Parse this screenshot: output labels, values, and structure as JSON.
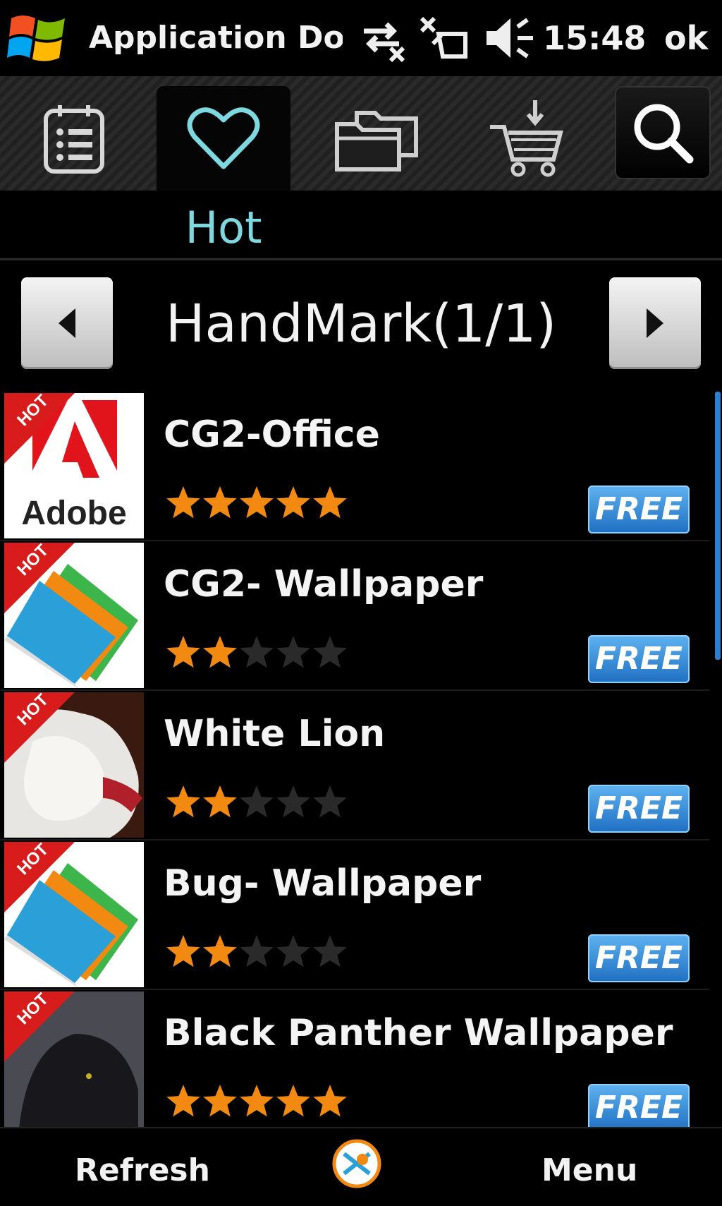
{
  "status_bar": {
    "app_title": "Application Dow",
    "time": "15:48",
    "ok_label": "ok",
    "icons": [
      "windows-start-icon",
      "connectivity-icon",
      "signal-off-icon",
      "volume-mute-icon"
    ]
  },
  "tabs": {
    "items": [
      {
        "icon": "list-icon"
      },
      {
        "icon": "heart-icon",
        "label": "Hot",
        "active": true
      },
      {
        "icon": "folders-icon"
      },
      {
        "icon": "cart-download-icon"
      }
    ],
    "search_icon": "search-icon",
    "active_label": "Hot"
  },
  "category": {
    "title": "HandMark(1/1)",
    "prev_icon": "chevron-left-icon",
    "next_icon": "chevron-right-icon"
  },
  "apps": [
    {
      "name": "CG2-Office",
      "rating": 5,
      "badge": "HOT",
      "price": "FREE",
      "thumb_text": "Adobe"
    },
    {
      "name": "CG2- Wallpaper",
      "rating": 2,
      "badge": "HOT",
      "price": "FREE"
    },
    {
      "name": "White Lion",
      "rating": 2,
      "badge": "HOT",
      "price": "FREE"
    },
    {
      "name": "Bug- Wallpaper",
      "rating": 2,
      "badge": "HOT",
      "price": "FREE"
    },
    {
      "name": "Black Panther Wallpaper",
      "rating": 5,
      "badge": "HOT",
      "price": "FREE"
    }
  ],
  "softkeys": {
    "left": "Refresh",
    "right": "Menu",
    "center_icon": "app-logo-icon"
  },
  "colors": {
    "accent": "#7ed8e0",
    "star": "#f28a12",
    "free_badge": "#2a80d0",
    "hot_badge": "#d81b1b"
  }
}
